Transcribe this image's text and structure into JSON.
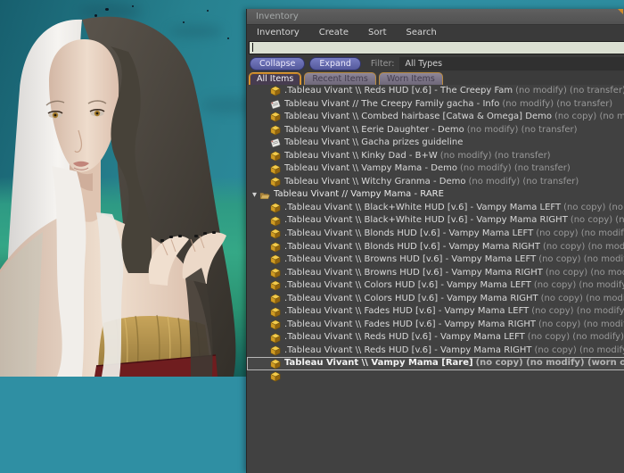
{
  "colors": {
    "scene_sky": "#2f8fa3",
    "scene_ground": "#35a886",
    "accent_orange": "#e8a23c",
    "button_purple": "#54599c",
    "tab_active_bg": "#473c50",
    "tab_inactive_bg": "#6c6577",
    "window_bg": "#414141",
    "titlebar_bg": "#575757",
    "search_field_bg": "#dbe0d2",
    "item_text": "#d9d9d9",
    "permission_text": "#999999",
    "object_icon_gold": "#f0c23f",
    "folder_icon_tan": "#c9a24e"
  },
  "window": {
    "title": "Inventory",
    "menus": [
      "Inventory",
      "Create",
      "Sort",
      "Search"
    ],
    "search": {
      "value": ""
    },
    "toolbar": {
      "collapse_label": "Collapse",
      "expand_label": "Expand",
      "filter_label": "Filter:",
      "filter_value": "All Types"
    },
    "tabs": [
      {
        "label": "All Items",
        "active": true
      },
      {
        "label": "Recent Items",
        "active": false
      },
      {
        "label": "Worn Items",
        "active": false
      }
    ],
    "items": [
      {
        "type": "object",
        "name": ".Tableau Vivant \\\\ Reds HUD [v.6] - The Creepy Fam",
        "perms": "(no modify) (no transfer)"
      },
      {
        "type": "notecard",
        "name": "Tableau Vivant // The Creepy Family gacha - Info",
        "perms": "(no modify) (no transfer)"
      },
      {
        "type": "object",
        "name": "Tableau Vivant \\\\ Combed hairbase [Catwa & Omega] Demo",
        "perms": "(no copy) (no modify) (no transfer)"
      },
      {
        "type": "object",
        "name": "Tableau Vivant \\\\ Eerie Daughter - Demo",
        "perms": "(no modify) (no transfer)"
      },
      {
        "type": "notecard",
        "name": "Tableau Vivant \\\\ Gacha prizes guideline",
        "perms": ""
      },
      {
        "type": "object",
        "name": "Tableau Vivant \\\\ Kinky Dad - B+W",
        "perms": "(no modify) (no transfer)"
      },
      {
        "type": "object",
        "name": "Tableau Vivant \\\\ Vampy Mama - Demo",
        "perms": "(no modify) (no transfer)"
      },
      {
        "type": "object",
        "name": "Tableau Vivant \\\\ Witchy Granma - Demo",
        "perms": "(no modify) (no transfer)"
      },
      {
        "type": "folder",
        "name": "Tableau Vivant // Vampy Mama - RARE",
        "perms": "",
        "expanded": true
      },
      {
        "type": "object",
        "name": ".Tableau Vivant \\\\ Black+White HUD [v.6] - Vampy Mama LEFT",
        "perms": "(no copy) (no modify)"
      },
      {
        "type": "object",
        "name": ".Tableau Vivant \\\\ Black+White HUD [v.6] - Vampy Mama RIGHT",
        "perms": "(no copy) (no modify)"
      },
      {
        "type": "object",
        "name": ".Tableau Vivant \\\\ Blonds HUD [v.6] - Vampy Mama LEFT",
        "perms": "(no copy) (no modify)"
      },
      {
        "type": "object",
        "name": ".Tableau Vivant \\\\ Blonds HUD [v.6] - Vampy Mama RIGHT",
        "perms": "(no copy) (no modify)"
      },
      {
        "type": "object",
        "name": ".Tableau Vivant \\\\ Browns HUD [v.6] - Vampy Mama LEFT",
        "perms": "(no copy) (no modify)"
      },
      {
        "type": "object",
        "name": ".Tableau Vivant \\\\ Browns HUD [v.6] - Vampy Mama RIGHT",
        "perms": "(no copy) (no modify)"
      },
      {
        "type": "object",
        "name": ".Tableau Vivant \\\\ Colors HUD [v.6] - Vampy Mama LEFT",
        "perms": "(no copy) (no modify)"
      },
      {
        "type": "object",
        "name": ".Tableau Vivant \\\\ Colors HUD [v.6] - Vampy Mama RIGHT",
        "perms": "(no copy) (no modify)"
      },
      {
        "type": "object",
        "name": ".Tableau Vivant \\\\ Fades HUD [v.6] - Vampy Mama LEFT",
        "perms": "(no copy) (no modify)"
      },
      {
        "type": "object",
        "name": ".Tableau Vivant \\\\ Fades HUD [v.6] - Vampy Mama RIGHT",
        "perms": "(no copy) (no modify)"
      },
      {
        "type": "object",
        "name": ".Tableau Vivant \\\\ Reds HUD [v.6] - Vampy Mama LEFT",
        "perms": "(no copy) (no modify)"
      },
      {
        "type": "object",
        "name": ".Tableau Vivant \\\\ Reds HUD [v.6] - Vampy Mama RIGHT",
        "perms": "(no copy) (no modify)"
      },
      {
        "type": "object",
        "name": "Tableau Vivant \\\\ Vampy Mama [Rare]",
        "perms": "(no copy) (no modify) (worn on Skull)",
        "worn": true,
        "selected": true
      },
      {
        "type": "object",
        "name": "",
        "perms": "",
        "partial": true
      }
    ]
  }
}
